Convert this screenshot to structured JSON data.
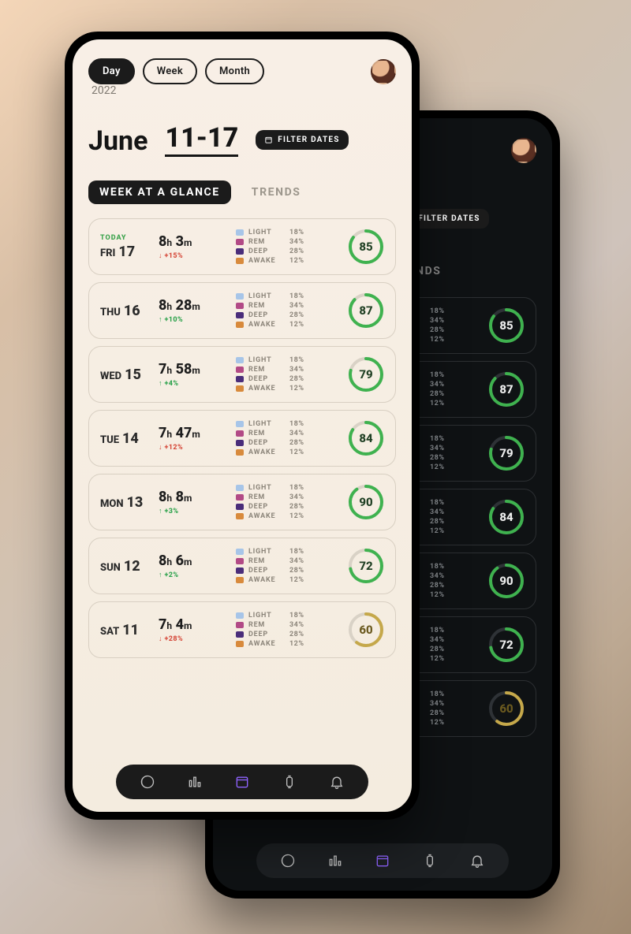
{
  "colors": {
    "light": "#a7c5e8",
    "rem": "#b24a86",
    "deep": "#4a2d7a",
    "awake": "#d88a3c",
    "ring_green": "#3fb24f",
    "ring_track": "#d9d2c6",
    "ring_track_dark": "#2e3236",
    "ring_warn": "#c5a84a"
  },
  "seg": {
    "day": "Day",
    "week": "Week",
    "month": "Month",
    "active": "Day"
  },
  "header": {
    "year": "2022",
    "month": "June",
    "range": "11-17",
    "filter_label": "FILTER DATES"
  },
  "tabs": {
    "a": "WEEK AT A GLANCE",
    "b": "TRENDS",
    "active": "a"
  },
  "today_label": "TODAY",
  "stage_labels": {
    "light": "LIGHT",
    "rem": "REM",
    "deep": "DEEP",
    "awake": "AWAKE"
  },
  "stage_values": {
    "light": "18%",
    "rem": "34%",
    "deep": "28%",
    "awake": "12%"
  },
  "days": [
    {
      "today": true,
      "dow": "FRI",
      "num": "17",
      "h": "8",
      "m": "3",
      "delta": "↓ +15%",
      "delta_dir": "down",
      "score": 85
    },
    {
      "today": false,
      "dow": "THU",
      "num": "16",
      "h": "8",
      "m": "28",
      "delta": "↑ +10%",
      "delta_dir": "up",
      "score": 87
    },
    {
      "today": false,
      "dow": "WED",
      "num": "15",
      "h": "7",
      "m": "58",
      "delta": "↑ +4%",
      "delta_dir": "up",
      "score": 79
    },
    {
      "today": false,
      "dow": "TUE",
      "num": "14",
      "h": "7",
      "m": "47",
      "delta": "↓ +12%",
      "delta_dir": "down",
      "score": 84
    },
    {
      "today": false,
      "dow": "MON",
      "num": "13",
      "h": "8",
      "m": "8",
      "delta": "↑ +3%",
      "delta_dir": "up",
      "score": 90
    },
    {
      "today": false,
      "dow": "SUN",
      "num": "12",
      "h": "8",
      "m": "6",
      "delta": "↑ +2%",
      "delta_dir": "up",
      "score": 72
    },
    {
      "today": false,
      "dow": "SAT",
      "num": "11",
      "h": "7",
      "m": "4",
      "delta": "↓ +28%",
      "delta_dir": "down",
      "score": 60
    }
  ]
}
